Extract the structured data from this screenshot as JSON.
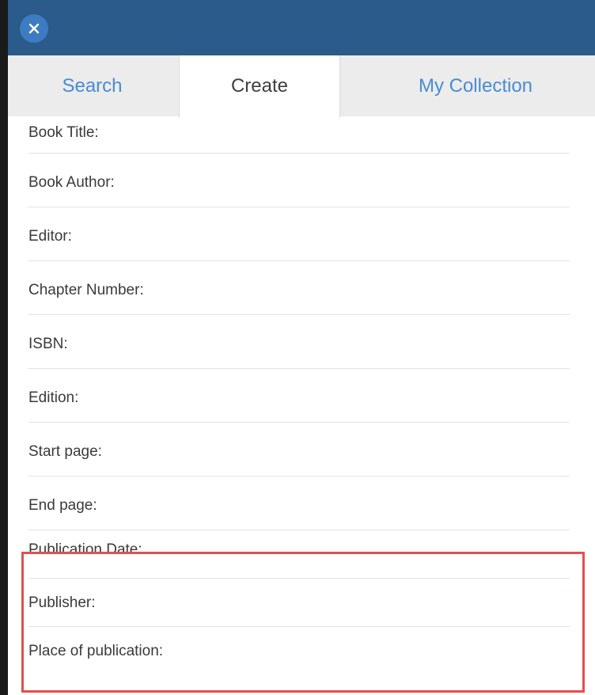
{
  "tabs": {
    "search": "Search",
    "create": "Create",
    "collection": "My Collection"
  },
  "close_icon": "close-icon",
  "fields": [
    {
      "label": "Book Title:"
    },
    {
      "label": "Book Author:"
    },
    {
      "label": "Editor:"
    },
    {
      "label": "Chapter Number:"
    },
    {
      "label": "ISBN:"
    },
    {
      "label": "Edition:"
    },
    {
      "label": "Start page:"
    },
    {
      "label": "End page:"
    },
    {
      "label": "Publication Date:"
    },
    {
      "label": "Publisher:"
    },
    {
      "label": "Place of publication:"
    }
  ],
  "colors": {
    "topbar": "#2a5b8a",
    "close_button": "#3d7bc2",
    "tab_active_text": "#404040",
    "tab_inactive_text": "#4a8bd1",
    "highlight": "#e0514f"
  }
}
